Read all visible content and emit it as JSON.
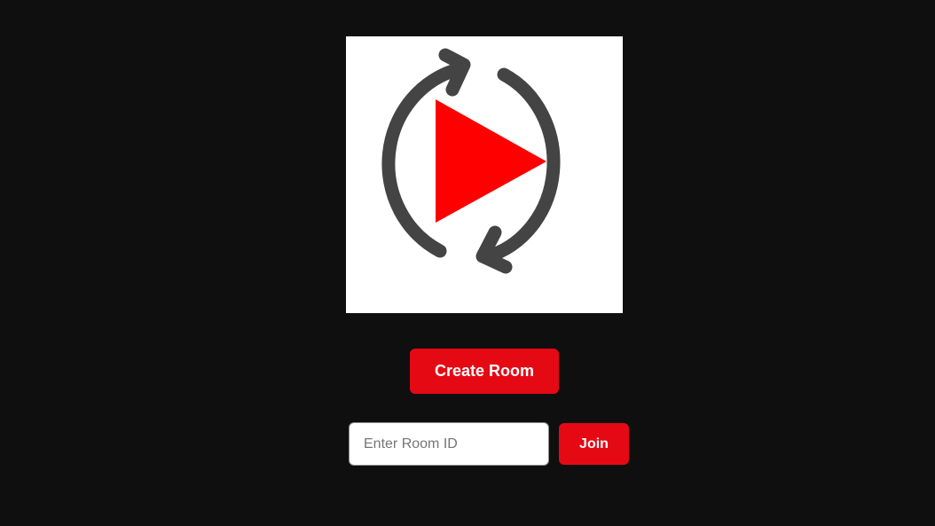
{
  "logo": {
    "icon": "sync-play-icon",
    "arrow_color": "#444444",
    "play_color": "#ff0000",
    "background": "#ffffff"
  },
  "actions": {
    "create_room_label": "Create Room",
    "join_label": "Join",
    "accent_color": "#e50914"
  },
  "room_input": {
    "placeholder": "Enter Room ID",
    "value": ""
  },
  "page": {
    "background": "#0f0f0f"
  }
}
